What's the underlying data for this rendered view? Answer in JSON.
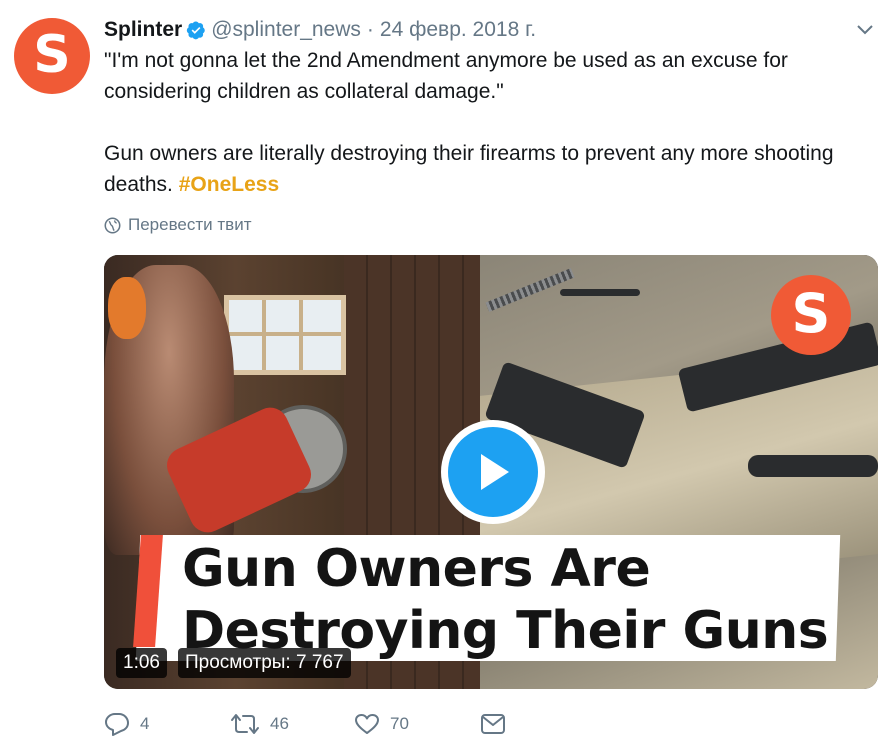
{
  "tweet": {
    "avatar_letter": "S",
    "display_name": "Splinter",
    "handle": "@splinter_news",
    "separator": "·",
    "date": "24 февр. 2018 г.",
    "text_line1": "\"I'm not gonna let the 2nd Amendment anymore be used as an excuse for considering children as collateral damage.\"",
    "text_line2_prefix": "Gun owners are literally destroying their firearms to prevent any more shooting deaths. ",
    "hashtag": "#OneLess",
    "translate_label": "Перевести твит"
  },
  "media": {
    "badge_letter": "S",
    "headline_line1": "Gun Owners Are",
    "headline_line2": "Destroying Their Guns",
    "duration": "1:06",
    "views": "Просмотры: 7 767"
  },
  "actions": {
    "reply_count": "4",
    "retweet_count": "46",
    "like_count": "70"
  },
  "colors": {
    "brand_orange": "#f05a36",
    "twitter_blue": "#1da1f2",
    "hashtag": "#e8a317",
    "secondary_text": "#657786"
  }
}
